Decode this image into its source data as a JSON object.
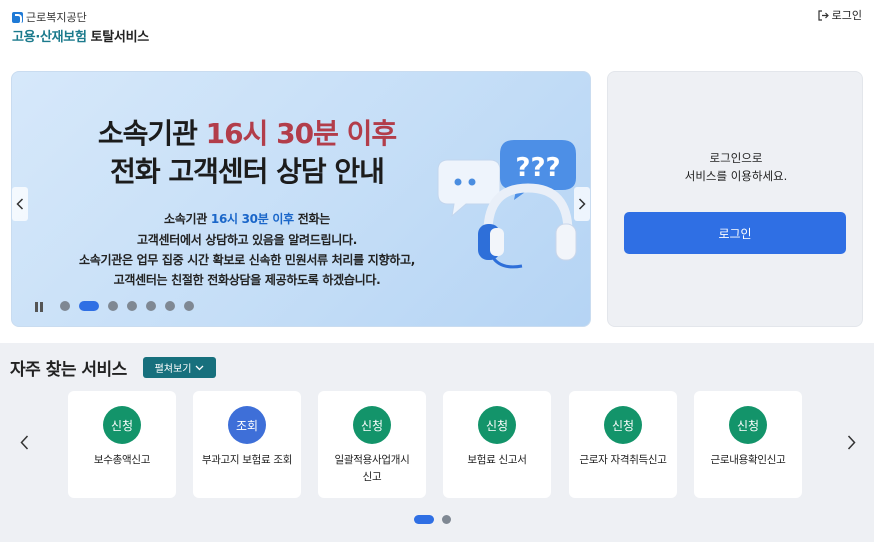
{
  "header": {
    "org_name": "근로복지공단",
    "title_part1": "고용·산재보험",
    "title_part2": "토탈서비스",
    "login_link": "로그인"
  },
  "banner": {
    "headline_prefix": "소속기관",
    "headline_highlight": "16시 30분 이후",
    "headline_line2": "전화 고객센터 상담 안내",
    "body_line1_prefix": "소속기관",
    "body_line1_highlight": "16시 30분 이후",
    "body_line1_suffix": "전화는",
    "body_line2": "고객센터에서 상담하고 있음을 알려드립니다.",
    "body_line3": "소속기관은 업무 집중 시간 확보로 신속한 민원서류 처리를 지향하고,",
    "body_line4": "고객센터는 친절한 전화상담을 제공하도록 하겠습니다.",
    "slide_count": 7,
    "active_slide": 2,
    "illustration_text": "???",
    "colors": {
      "highlight": "#b23d4a",
      "body_highlight": "#1a66c9",
      "active_dot": "#2f6fe4"
    }
  },
  "login_panel": {
    "message_line1": "로그인으로",
    "message_line2": "서비스를 이용하세요.",
    "button_label": "로그인"
  },
  "services": {
    "title": "자주 찾는 서비스",
    "expand_label": "펼쳐보기",
    "cards": [
      {
        "badge": "신청",
        "badge_color": "green",
        "label": "보수총액신고"
      },
      {
        "badge": "조회",
        "badge_color": "blue",
        "label": "부과고지 보험료 조회"
      },
      {
        "badge": "신청",
        "badge_color": "green",
        "label": "일괄적용사업개시신고"
      },
      {
        "badge": "신청",
        "badge_color": "green",
        "label": "보험료 신고서"
      },
      {
        "badge": "신청",
        "badge_color": "green",
        "label": "근로자 자격취득신고"
      },
      {
        "badge": "신청",
        "badge_color": "green",
        "label": "근로내용확인신고"
      }
    ],
    "page_count": 2,
    "active_page": 1
  }
}
